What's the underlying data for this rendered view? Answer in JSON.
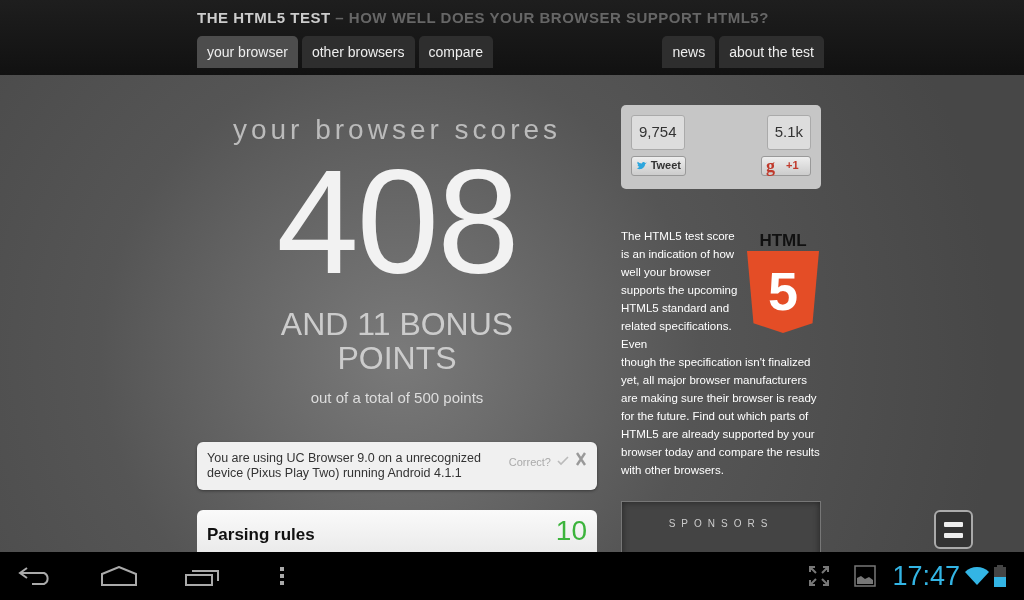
{
  "header": {
    "title": "THE HTML5 TEST",
    "subtitle": "– HOW WELL DOES YOUR BROWSER SUPPORT HTML5?"
  },
  "tabs_left": [
    {
      "label": "your browser",
      "selected": true
    },
    {
      "label": "other browsers",
      "selected": false
    },
    {
      "label": "compare",
      "selected": false
    }
  ],
  "tabs_right": [
    {
      "label": "news",
      "selected": false
    },
    {
      "label": "about the test",
      "selected": false
    }
  ],
  "score": {
    "heading": "your browser scores",
    "value": "408",
    "bonus": "AND 11 BONUS POINTS",
    "total": "out of a total of 500 points"
  },
  "notice": {
    "text": "You are using UC Browser 9.0 on a unrecognized device (Pixus Play Two) running Android 4.1.1",
    "correct_label": "Correct?"
  },
  "sections": [
    {
      "title": "Parsing rules",
      "points": "10"
    }
  ],
  "social": {
    "tweet_count": "9,754",
    "tweet_label": "Tweet",
    "plus_count": "5.1k",
    "plus_logo": "g",
    "plus_label": "+1"
  },
  "html5_logo": {
    "word": "HTML",
    "numeral": "5"
  },
  "description": [
    "The HTML5 test score is an indication of how well your browser supports the upcoming HTML5 standard and related specifications. Even",
    "though the specification isn't finalized yet, all major browser manufacturers are making sure their browser is ready for the future. Find out which parts of HTML5 are already supported by your browser today and compare the results with other browsers."
  ],
  "sponsors": {
    "label": "SPONSORS"
  },
  "system_bar": {
    "time": "17:47"
  }
}
